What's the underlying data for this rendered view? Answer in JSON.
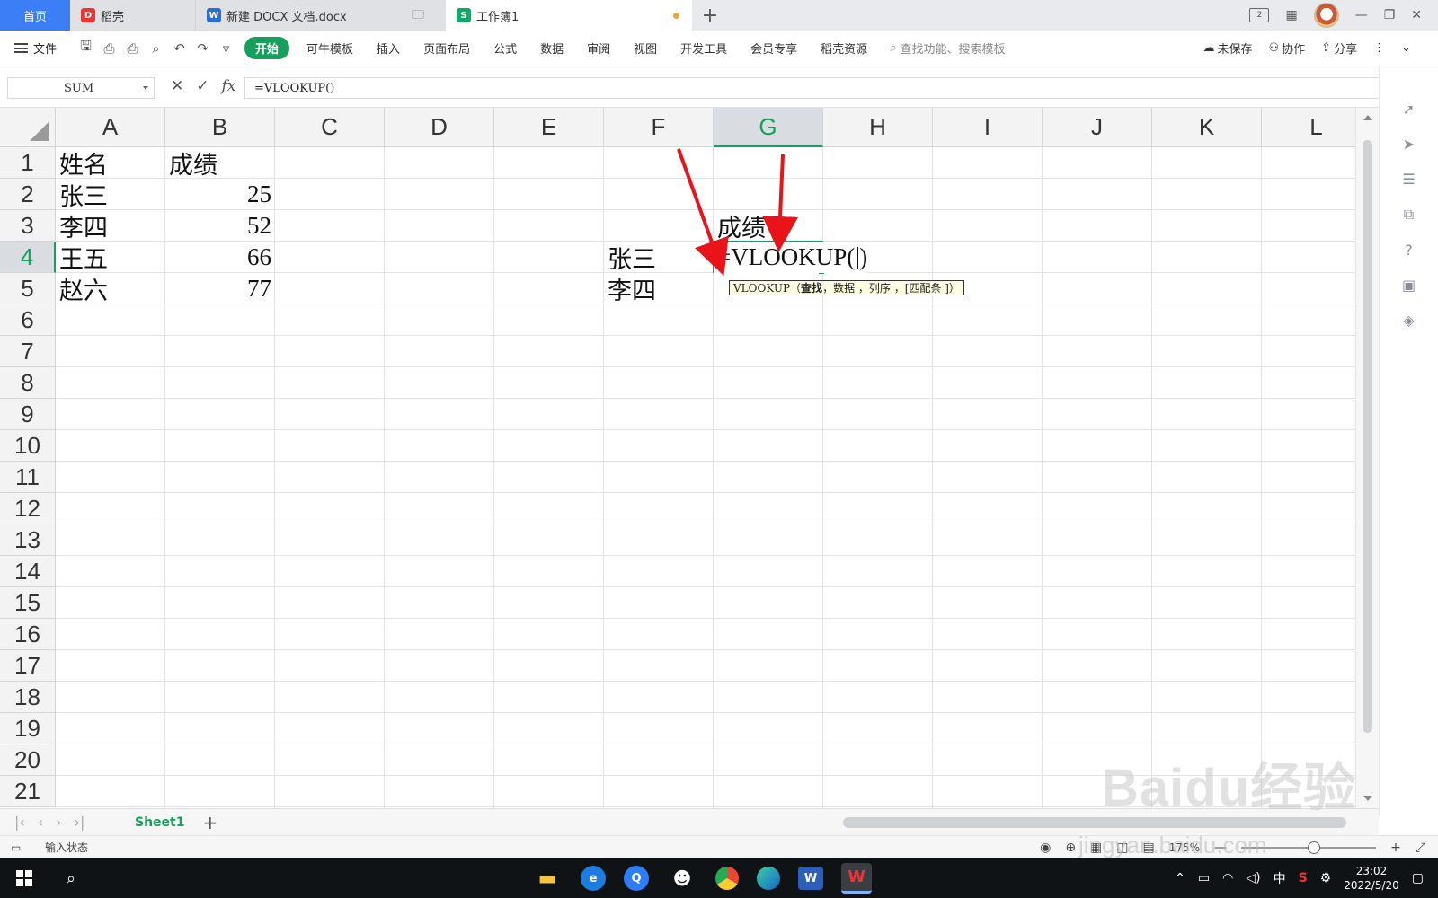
{
  "tabs": {
    "home": "首页",
    "daoke": "稻壳",
    "docx": "新建 DOCX 文档.docx",
    "workbook": "工作簿1",
    "add": "+"
  },
  "ribbon": {
    "file": "文件",
    "tabs": [
      "开始",
      "可牛模板",
      "插入",
      "页面布局",
      "公式",
      "数据",
      "审阅",
      "视图",
      "开发工具",
      "会员专享",
      "稻壳资源"
    ],
    "search_placeholder": "查找功能、搜索模板",
    "unsaved": "未保存",
    "collab": "协作",
    "share": "分享"
  },
  "formula_bar": {
    "name_box": "SUM",
    "fx": "fx",
    "formula": "=VLOOKUP()"
  },
  "grid": {
    "columns": [
      "A",
      "B",
      "C",
      "D",
      "E",
      "F",
      "G",
      "H",
      "I",
      "J",
      "K",
      "L"
    ],
    "rows": [
      "1",
      "2",
      "3",
      "4",
      "5",
      "6",
      "7",
      "8",
      "9",
      "10",
      "11",
      "12",
      "13",
      "14",
      "15",
      "16",
      "17",
      "18",
      "19",
      "20",
      "21"
    ],
    "selected_column": "G",
    "selected_row": "4",
    "cells": {
      "A1": "姓名",
      "B1": "成绩",
      "A2": "张三",
      "B2": "25",
      "A3": "李四",
      "B3": "52",
      "A4": "王五",
      "B4": "66",
      "A5": "赵六",
      "B5": "77",
      "G3": "成绩",
      "F4": "张三",
      "F5": "李四"
    },
    "editing_value_prefix": "=VLOOKUP(",
    "editing_value_suffix": ")",
    "tooltip": {
      "fn": "VLOOKUP（",
      "arg1": "查找",
      "rest": "，数据 ，列序 ，[匹配条 ]）"
    }
  },
  "sheets": {
    "active": "Sheet1",
    "add": "+"
  },
  "status": {
    "mode": "输入状态",
    "zoom": "175%"
  },
  "taskbar": {
    "ime": "中",
    "time": "23:02",
    "date": "2022/5/20"
  },
  "watermark": {
    "text": "Baidu经验",
    "url": "jingyan.baidu.com"
  },
  "colors": {
    "accent": "#17a05d",
    "arrow": "#e8141a",
    "tab_home": "#3c7ef5"
  }
}
